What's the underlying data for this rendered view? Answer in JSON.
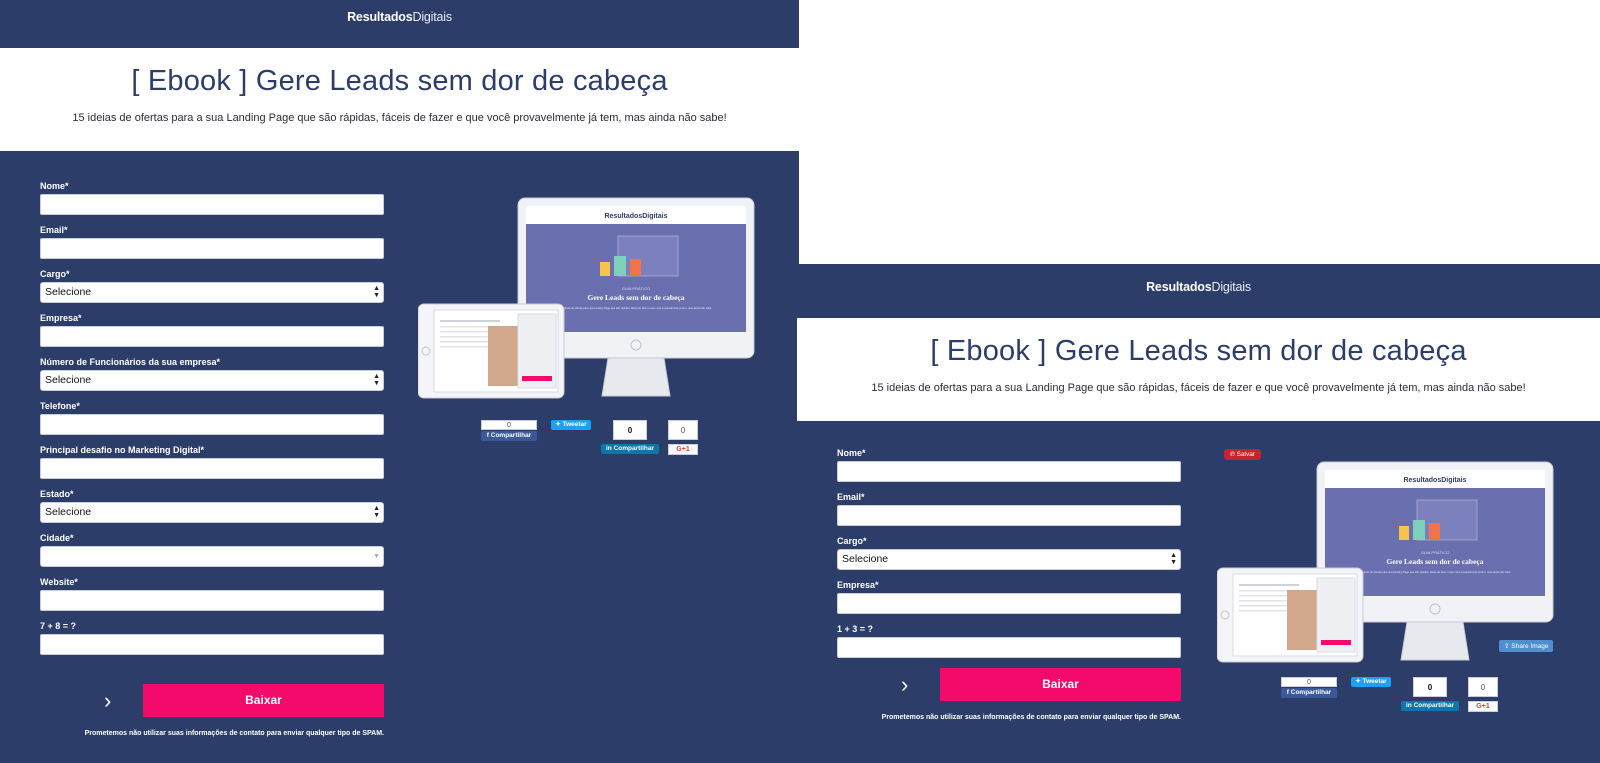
{
  "brand": {
    "bold": "Resultados",
    "light": "Digitais"
  },
  "hero": {
    "title": "[ Ebook ] Gere Leads sem dor de cabeça",
    "subtitle": "15 ideias de ofertas para a sua Landing Page que são rápidas, fáceis de fazer e que você provavelmente já tem, mas ainda não sabe!"
  },
  "form_long": {
    "fields": [
      {
        "label": "Nome*"
      },
      {
        "label": "Email*"
      },
      {
        "label": "Cargo*",
        "value": "Selecione"
      },
      {
        "label": "Empresa*"
      },
      {
        "label": "Número de Funcionários da sua empresa*",
        "value": "Selecione"
      },
      {
        "label": "Telefone*"
      },
      {
        "label": "Principal desafio no Marketing Digital*"
      },
      {
        "label": "Estado*",
        "value": "Selecione"
      },
      {
        "label": "Cidade*"
      },
      {
        "label": "Website*"
      },
      {
        "label": "7 + 8 = ?"
      }
    ]
  },
  "form_short": {
    "fields": [
      {
        "label": "Nome*"
      },
      {
        "label": "Email*"
      },
      {
        "label": "Cargo*",
        "value": "Selecione"
      },
      {
        "label": "Empresa*"
      },
      {
        "label": "1 + 3 = ?"
      }
    ]
  },
  "submit": {
    "label": "Baixar"
  },
  "spam_notice": "Prometemos não utilizar suas informações de contato para enviar qualquer tipo de SPAM.",
  "mockup": {
    "brand": "ResultadosDigitais",
    "kicker": "GUIA PRÁTICO",
    "title": "Gere Leads sem dor de cabeça",
    "desc": "15 ideias de ofertas para sua Landing Page que são rápidas, fáceis de fazer e que você provavelmente já tem, mas ainda não sabe."
  },
  "social": {
    "fb_count": "0",
    "fb_label": "Compartilhar",
    "tw_label": "Tweetar",
    "li_count": "0",
    "li_label": "Compartilhar",
    "gp_count": "0",
    "gp_label": "G+1"
  },
  "pin_label": "Salvar",
  "share_image_label": "Share Image",
  "colors": {
    "navy": "#2b3d68",
    "accent": "#f40a6a",
    "facebook": "#3b5998",
    "twitter": "#1da1f2",
    "linkedin": "#0e76a8",
    "pinterest": "#c8232c"
  }
}
